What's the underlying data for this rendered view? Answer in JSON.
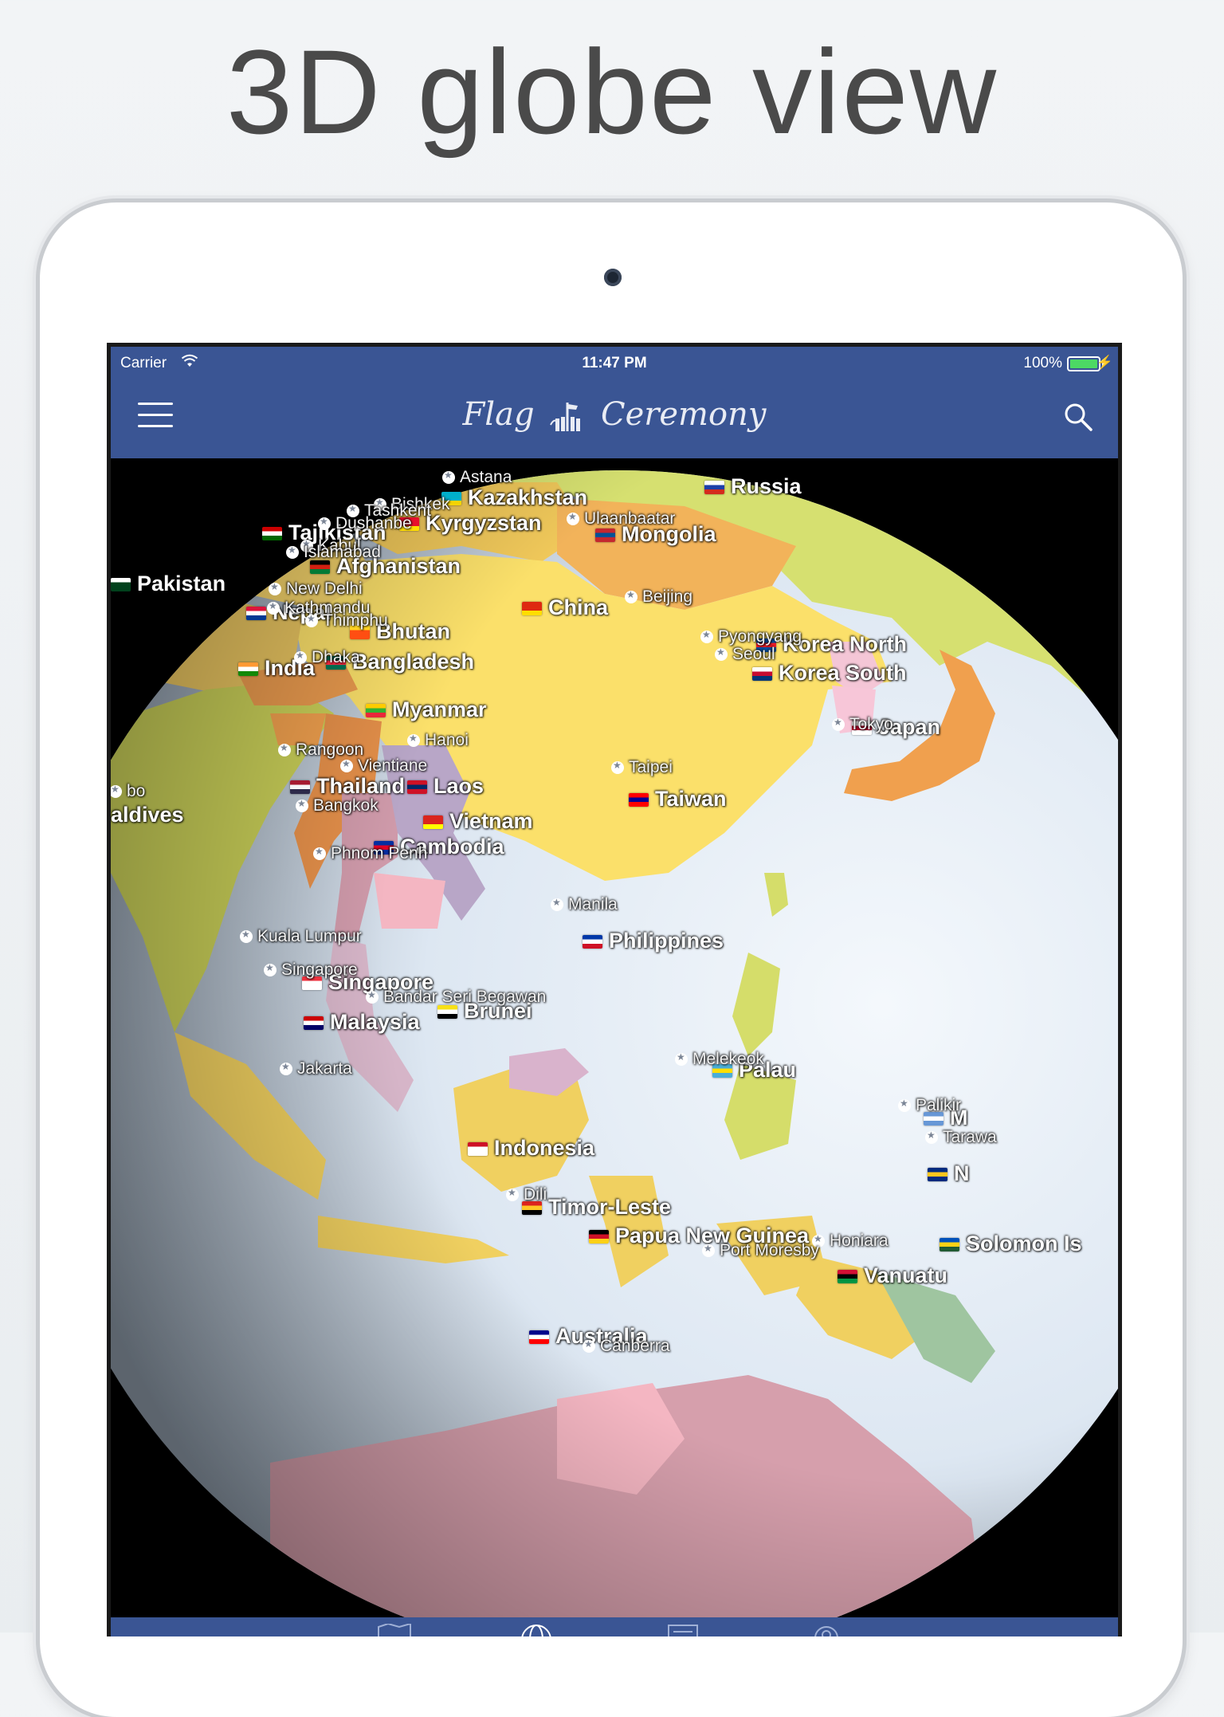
{
  "headline": "3D globe view",
  "status_bar": {
    "carrier": "Carrier",
    "time": "11:47 PM",
    "battery": "100%"
  },
  "nav": {
    "app_title_left": "Flag",
    "app_title_right": "Ceremony",
    "menu_icon": "hamburger-icon",
    "search_icon": "search-icon"
  },
  "colors": {
    "nav_bg": "#3a5594",
    "ocean": "#dce7f3",
    "space": "#000000"
  },
  "map": {
    "countries": [
      {
        "name": "Russia",
        "flag": [
          "#ffffff",
          "#1c3fa8",
          "#d52b1e"
        ]
      },
      {
        "name": "Kazakhstan",
        "flag": [
          "#00afca",
          "#00afca",
          "#f5d400"
        ]
      },
      {
        "name": "Kyrgyzstan",
        "flag": [
          "#e8112d",
          "#e8112d",
          "#ffde00"
        ]
      },
      {
        "name": "Tajikistan",
        "flag": [
          "#cc0000",
          "#ffffff",
          "#006600"
        ]
      },
      {
        "name": "Mongolia",
        "flag": [
          "#c4272f",
          "#015197",
          "#c4272f"
        ]
      },
      {
        "name": "Afghanistan",
        "flag": [
          "#000000",
          "#d32011",
          "#007a36"
        ]
      },
      {
        "name": "Pakistan",
        "flag": [
          "#ffffff",
          "#01411c",
          "#01411c"
        ]
      },
      {
        "name": "Nepal",
        "flag": [
          "#dc143c",
          "#ffffff",
          "#003893"
        ]
      },
      {
        "name": "China",
        "flag": [
          "#de2910",
          "#de2910",
          "#ffde00"
        ]
      },
      {
        "name": "Bhutan",
        "flag": [
          "#ffd520",
          "#ff4e12",
          "#ff4e12"
        ]
      },
      {
        "name": "Korea North",
        "flag": [
          "#024fa2",
          "#ed1c27",
          "#024fa2"
        ]
      },
      {
        "name": "Korea South",
        "flag": [
          "#ffffff",
          "#c60c30",
          "#003478"
        ]
      },
      {
        "name": "India",
        "flag": [
          "#ff9933",
          "#ffffff",
          "#138808"
        ]
      },
      {
        "name": "Bangladesh",
        "flag": [
          "#006a4e",
          "#f42a41",
          "#006a4e"
        ]
      },
      {
        "name": "Myanmar",
        "flag": [
          "#fecb00",
          "#34b233",
          "#ea2839"
        ]
      },
      {
        "name": "Japan",
        "flag": [
          "#ffffff",
          "#bc002d",
          "#ffffff"
        ]
      },
      {
        "name": "Thailand",
        "flag": [
          "#a51931",
          "#f4f5f8",
          "#2d2a4a"
        ]
      },
      {
        "name": "Laos",
        "flag": [
          "#ce1126",
          "#002868",
          "#ce1126"
        ]
      },
      {
        "name": "Taiwan",
        "flag": [
          "#fe0000",
          "#000095",
          "#fe0000"
        ]
      },
      {
        "name": "aldives",
        "flag": null
      },
      {
        "name": "Vietnam",
        "flag": [
          "#da251d",
          "#da251d",
          "#ffff00"
        ]
      },
      {
        "name": "Cambodia",
        "flag": [
          "#032ea1",
          "#e00025",
          "#032ea1"
        ]
      },
      {
        "name": "Philippines",
        "flag": [
          "#0038a8",
          "#ffffff",
          "#ce1126"
        ]
      },
      {
        "name": "Singapore",
        "flag": [
          "#ef3340",
          "#ffffff",
          "#ffffff"
        ]
      },
      {
        "name": "Brunei",
        "flag": [
          "#f7e017",
          "#ffffff",
          "#000000"
        ]
      },
      {
        "name": "Malaysia",
        "flag": [
          "#cc0001",
          "#ffffff",
          "#010066"
        ]
      },
      {
        "name": "Palau",
        "flag": [
          "#4aadd6",
          "#ffde00",
          "#4aadd6"
        ]
      },
      {
        "name": "M",
        "flag": [
          "#6797d6",
          "#ffffff",
          "#6797d6"
        ]
      },
      {
        "name": "Indonesia",
        "flag": [
          "#ce1126",
          "#ffffff",
          "#ffffff"
        ]
      },
      {
        "name": "N",
        "flag": [
          "#002b7f",
          "#ffc61e",
          "#002b7f"
        ]
      },
      {
        "name": "Timor-Leste",
        "flag": [
          "#dc241f",
          "#ffc726",
          "#000000"
        ]
      },
      {
        "name": "Papua New Guinea",
        "flag": [
          "#000000",
          "#ce1126",
          "#fcd116"
        ]
      },
      {
        "name": "Solomon Is",
        "flag": [
          "#0051ba",
          "#fcd116",
          "#215b33"
        ]
      },
      {
        "name": "Vanuatu",
        "flag": [
          "#d21034",
          "#000000",
          "#009543"
        ]
      },
      {
        "name": "Australia",
        "flag": [
          "#00008b",
          "#ffffff",
          "#ff0000"
        ]
      }
    ],
    "capitals": [
      "Astana",
      "Bishkek",
      "Tashkent",
      "Dushanbe",
      "Ulaanbaatar",
      "Kabul",
      "Islamabad",
      "New Delhi",
      "Kathmandu",
      "Thimphu",
      "Beijing",
      "Pyongyang",
      "Seoul",
      "Dhaka",
      "Tokyo",
      "Hanoi",
      "Rangoon",
      "Vientiane",
      "Taipei",
      "bo",
      "Bangkok",
      "Phnom Penh",
      "Manila",
      "Kuala Lumpur",
      "Singapore",
      "Bandar Seri Begawan",
      "Melekeok",
      "Jakarta",
      "Palikir",
      "Tarawa",
      "Dili",
      "Honiara",
      "Port Moresby",
      "Canberra"
    ]
  },
  "tabs": [
    {
      "id": "map",
      "icon": "map-icon"
    },
    {
      "id": "globe",
      "icon": "globe-icon"
    },
    {
      "id": "cards",
      "icon": "cards-icon"
    },
    {
      "id": "profile",
      "icon": "profile-icon"
    }
  ]
}
